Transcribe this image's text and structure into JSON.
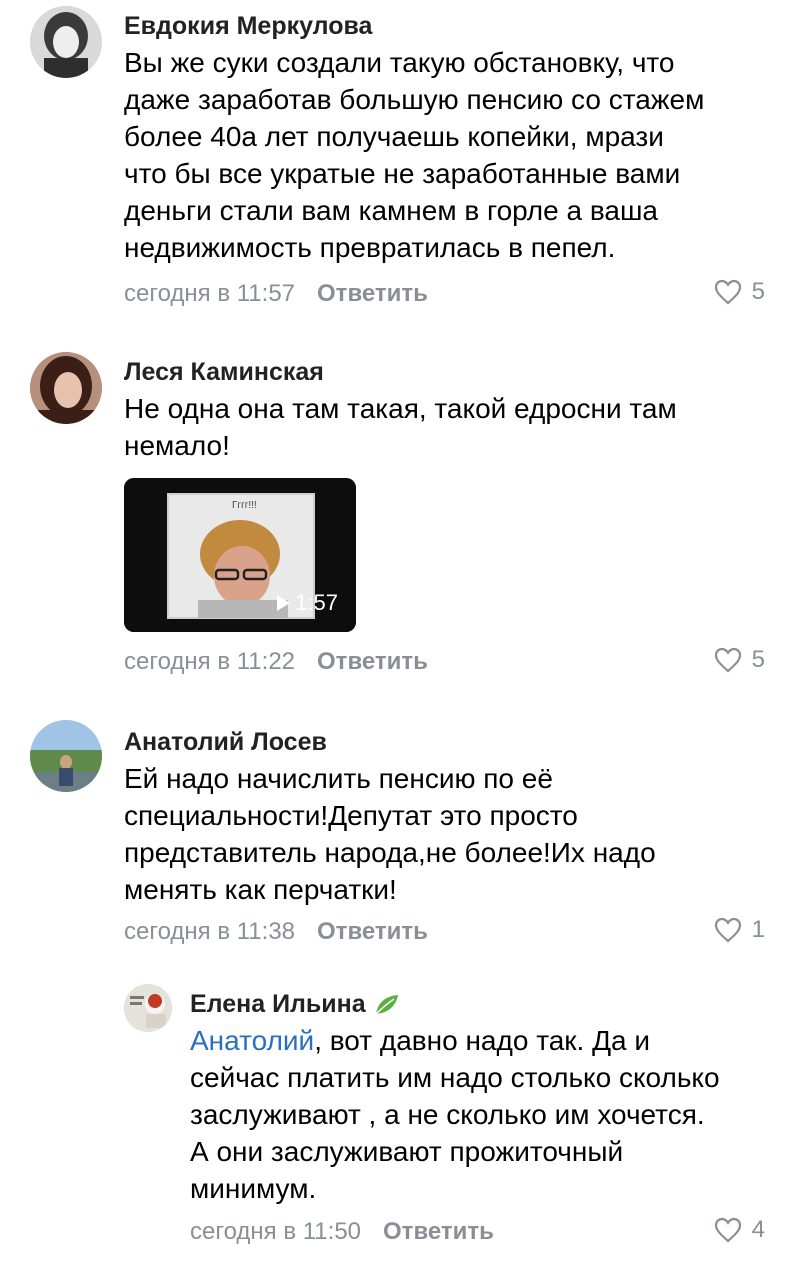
{
  "comments": [
    {
      "author": "Евдокия Меркулова",
      "lines": [
        "Вы же суки создали такую обстановку, что",
        "даже заработав большую пенсию со стажем",
        "более 40а лет получаешь копейки, мрази",
        "что бы все укратые не заработанные вами",
        "деньги стали вам камнем в горле а ваша",
        "недвижимость превратилась в пепел."
      ],
      "time": "сегодня в 11:57",
      "reply_label": "Ответить",
      "likes": "5"
    },
    {
      "author": "Леся Каминская",
      "lines": [
        "Не одна она там такая, такой едросни там",
        "немало!"
      ],
      "video": {
        "caption": "Гггг!!!",
        "duration": "1:57"
      },
      "time": "сегодня в 11:22",
      "reply_label": "Ответить",
      "likes": "5"
    },
    {
      "author": "Анатолий Лосев",
      "lines": [
        "Ей надо начислить пенсию по её",
        "специальности!Депутат это просто",
        "представитель народа,не более!Их надо",
        "менять как перчатки!"
      ],
      "time": "сегодня в 11:38",
      "reply_label": "Ответить",
      "likes": "1"
    },
    {
      "author": "Елена Ильина",
      "mention": "Анатолий",
      "first_line_rest": ", вот давно надо так. Да и",
      "lines": [
        "сейчас платить им надо столько сколько",
        "заслуживают , а не сколько им хочется.",
        "А они заслуживают прожиточный",
        "минимум."
      ],
      "time": "сегодня в 11:50",
      "reply_label": "Ответить",
      "likes": "4"
    }
  ],
  "colors": {
    "meta": "#8a8f96",
    "mention": "#2a6fbf",
    "leaf": "#5cb040"
  },
  "icons": [
    "heart-icon",
    "play-icon",
    "leaf-icon"
  ]
}
